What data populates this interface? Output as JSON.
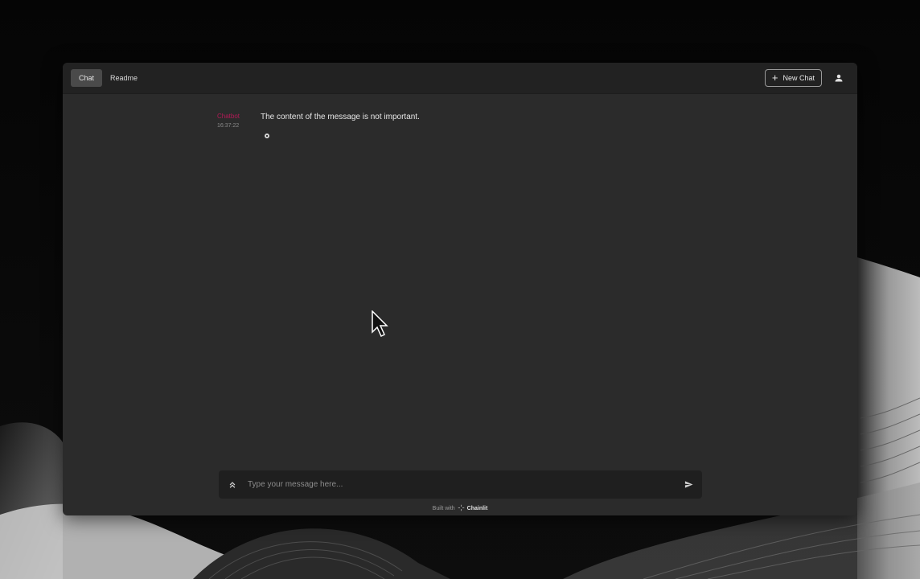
{
  "header": {
    "tabs": [
      {
        "label": "Chat",
        "active": true
      },
      {
        "label": "Readme",
        "active": false
      }
    ],
    "new_chat_label": "New Chat",
    "new_chat_icon": "plus-icon",
    "user_icon": "user-icon"
  },
  "messages": [
    {
      "author": "Chatbot",
      "time": "16:37:22",
      "content": "The content of the message is not important.",
      "action_icon": "gear-icon"
    }
  ],
  "composer": {
    "placeholder": "Type your message here...",
    "value": "",
    "settings_icon": "chevrons-up-icon",
    "send_icon": "send-icon"
  },
  "footer": {
    "prefix": "Built with",
    "brand": "Chainlit"
  },
  "colors": {
    "background": "#0a0a0a",
    "window": "#2b2b2b",
    "topbar": "#222222",
    "author": "#c2185b",
    "input": "#1f1f1f"
  }
}
